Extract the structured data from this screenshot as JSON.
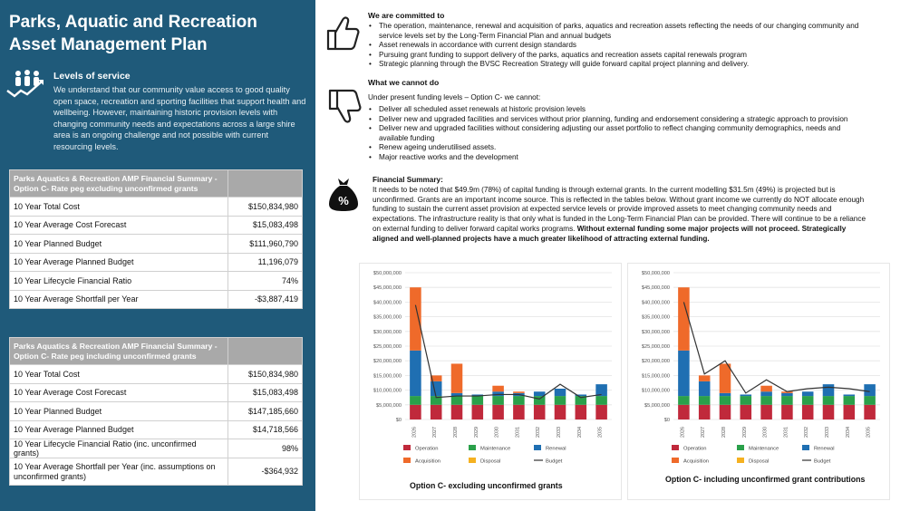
{
  "title": "Parks, Aquatic and Recreation Asset Management Plan",
  "levels_of_service": {
    "heading": "Levels of service",
    "text": "We understand that our community value access to good quality open space, recreation and sporting facilities that support health and wellbeing. However, maintaining historic provision levels with changing community needs and expectations across a large shire area is an ongoing challenge and not possible with current resourcing levels."
  },
  "table1": {
    "header": "Parks Aquatics & Recreation AMP Financial Summary - Option C- Rate peg excluding unconfirmed grants",
    "rows": [
      {
        "label": "10 Year Total Cost",
        "value": "$150,834,980"
      },
      {
        "label": "10 Year Average Cost Forecast",
        "value": "$15,083,498"
      },
      {
        "label": "10 Year Planned Budget",
        "value": "$111,960,790"
      },
      {
        "label": "10 Year Average Planned Budget",
        "value": "11,196,079"
      },
      {
        "label": "10 Year Lifecycle Financial Ratio",
        "value": "74%"
      },
      {
        "label": "10 Year  Average Shortfall per Year",
        "value": "-$3,887,419"
      }
    ]
  },
  "table2": {
    "header": "Parks Aquatics & Recreation AMP Financial Summary - Option C- Rate peg  including unconfirmed grants",
    "rows": [
      {
        "label": "10 Year Total Cost",
        "value": "$150,834,980"
      },
      {
        "label": "10 Year Average Cost Forecast",
        "value": "$15,083,498"
      },
      {
        "label": "10 Year Planned Budget",
        "value": "$147,185,660"
      },
      {
        "label": "10 Year Average Planned Budget",
        "value": "$14,718,566"
      },
      {
        "label": "10 Year Lifecycle Financial Ratio (inc. unconfirmed grants)",
        "value": "98%"
      },
      {
        "label": "10 Year Average Shortfall per Year (inc. assumptions on unconfirmed grants)",
        "value": "-$364,932"
      }
    ]
  },
  "committed": {
    "heading": "We are committed to",
    "items": [
      "The operation, maintenance, renewal and acquisition of parks, aquatics and recreation assets reflecting the needs of our changing  community and service levels set by the Long-Term Financial Plan and annual budgets",
      "Asset renewals in accordance with current design standards",
      "Pursuing grant funding to support delivery of the parks, aquatics and recreation assets capital renewals program",
      "Strategic planning  through  the  BVSC Recreation Strategy will guide  forward capital project planning and delivery."
    ]
  },
  "cannot": {
    "heading": "What we cannot do",
    "intro": "Under present funding levels – Option C- we cannot:",
    "items": [
      "Deliver all scheduled asset renewals at historic provision levels",
      "Deliver new and upgraded facilities and services without prior planning, funding and endorsement considering a strategic approach to provision",
      "Deliver  new and upgraded facilities without considering  adjusting our asset portfolio to reflect  changing community demographics, needs and available funding",
      "Renew ageing underutilised assets.",
      "Major reactive works and the development"
    ]
  },
  "financial": {
    "heading": "Financial Summary:",
    "text": "It needs to be noted that $49.9m (78%) of capital funding is through external grants. In the current modelling  $31.5m (49%)  is projected  but is unconfirmed. Grants are an important income source. This is reflected in the tables below. Without  grant income we currently do NOT allocate enough funding to sustain the current asset provision at expected service levels or provide improved assets to meet changing community needs and expectations. The infrastructure reality is that only what is funded in the Long-Term Financial Plan can be provided. There will continue to be a reliance on external funding to deliver forward capital works programs. ",
    "bold": "Without external funding some major projects will not proceed. Strategically aligned and well-planned projects have  a much greater likelihood of attracting external funding."
  },
  "colors": {
    "panel": "#1f5a7a",
    "operation": "#c0293b",
    "maintenance": "#2aa04a",
    "renewal": "#1f6fb2",
    "acquisition": "#ef6a2a",
    "disposal": "#f5b120",
    "budget": "#333333"
  },
  "chart_data": [
    {
      "type": "bar",
      "caption": "Option C- excluding unconfirmed grants",
      "categories": [
        "2026",
        "2027",
        "2028",
        "2029",
        "2030",
        "2031",
        "2032",
        "2033",
        "2034",
        "2035"
      ],
      "ylim": [
        0,
        50000000
      ],
      "yticks": [
        "$0",
        "$5,000,000",
        "$10,000,000",
        "$15,000,000",
        "$20,000,000",
        "$25,000,000",
        "$30,000,000",
        "$35,000,000",
        "$40,000,000",
        "$45,000,000",
        "$50,000,000"
      ],
      "series": [
        {
          "name": "Operation",
          "values": [
            5000000,
            5000000,
            5000000,
            5000000,
            5000000,
            5000000,
            5000000,
            5000000,
            5000000,
            5000000
          ]
        },
        {
          "name": "Maintenance",
          "values": [
            3000000,
            3000000,
            3000000,
            3000000,
            3000000,
            3000000,
            3000000,
            3000000,
            3000000,
            3000000
          ]
        },
        {
          "name": "Renewal",
          "values": [
            15500000,
            5000000,
            1000000,
            500000,
            1500000,
            1000000,
            1500000,
            2500000,
            500000,
            4000000
          ]
        },
        {
          "name": "Acquisition",
          "values": [
            21500000,
            2000000,
            10000000,
            0,
            2000000,
            500000,
            0,
            0,
            0,
            0
          ]
        },
        {
          "name": "Disposal",
          "values": [
            0,
            0,
            0,
            0,
            0,
            0,
            0,
            0,
            0,
            0
          ]
        },
        {
          "name": "Budget",
          "values": [
            39000000,
            7500000,
            8000000,
            8000000,
            8500000,
            8500000,
            7000000,
            12000000,
            7500000,
            8500000
          ]
        }
      ]
    },
    {
      "type": "bar",
      "caption": "Option C- including unconfirmed grant contributions",
      "categories": [
        "2026",
        "2027",
        "2028",
        "2029",
        "2030",
        "2031",
        "2032",
        "2033",
        "2034",
        "2035"
      ],
      "ylim": [
        0,
        50000000
      ],
      "yticks": [
        "$0",
        "$5,000,000",
        "$10,000,000",
        "$15,000,000",
        "$20,000,000",
        "$25,000,000",
        "$30,000,000",
        "$35,000,000",
        "$40,000,000",
        "$45,000,000",
        "$50,000,000"
      ],
      "series": [
        {
          "name": "Operation",
          "values": [
            5000000,
            5000000,
            5000000,
            5000000,
            5000000,
            5000000,
            5000000,
            5000000,
            5000000,
            5000000
          ]
        },
        {
          "name": "Maintenance",
          "values": [
            3000000,
            3000000,
            3000000,
            3000000,
            3000000,
            3000000,
            3000000,
            3000000,
            3000000,
            3000000
          ]
        },
        {
          "name": "Renewal",
          "values": [
            15500000,
            5000000,
            1000000,
            500000,
            1500000,
            1000000,
            1500000,
            4000000,
            500000,
            4000000
          ]
        },
        {
          "name": "Acquisition",
          "values": [
            21500000,
            2000000,
            10000000,
            0,
            2000000,
            500000,
            0,
            0,
            0,
            0
          ]
        },
        {
          "name": "Disposal",
          "values": [
            0,
            0,
            0,
            0,
            0,
            0,
            0,
            0,
            0,
            0
          ]
        },
        {
          "name": "Budget",
          "values": [
            40000000,
            15500000,
            20000000,
            9000000,
            13500000,
            9500000,
            10500000,
            11000000,
            10500000,
            9500000
          ]
        }
      ]
    }
  ]
}
